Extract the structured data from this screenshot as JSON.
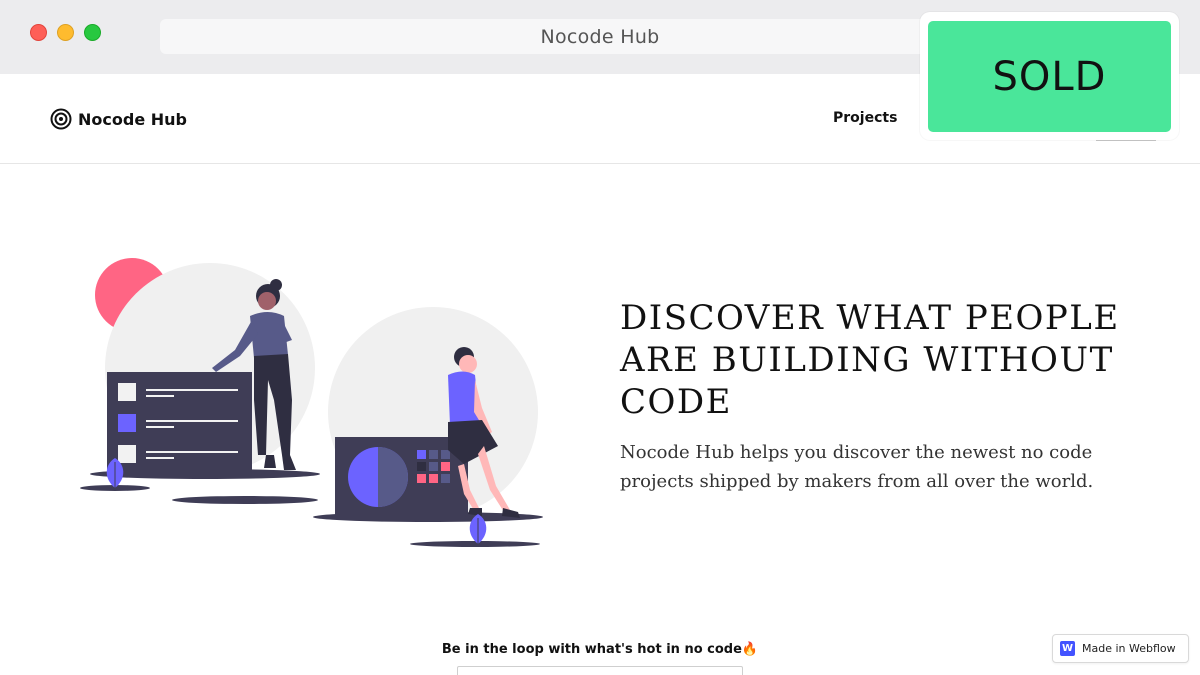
{
  "browser": {
    "address_text": "Nocode Hub"
  },
  "nav": {
    "brand": "Nocode Hub",
    "brand_icon": "target-icon",
    "links": [
      {
        "label": "Projects"
      }
    ]
  },
  "badge": {
    "label": "SOLD",
    "color": "#4ae69a"
  },
  "hero": {
    "title": "DISCOVER WHAT PEOPLE ARE BUILDING WITHOUT CODE",
    "description": "Nocode Hub helps you discover the newest no code projects shipped by makers from all over the world.",
    "illustration": "people-with-dashboard-illustration",
    "accent_color": "#6c63ff",
    "pink_color": "#ff6584"
  },
  "newsletter": {
    "title": "Be in the loop with what's hot in no code🔥"
  },
  "footer_badge": {
    "label": "Made in Webflow",
    "icon_letter": "W",
    "color": "#4353ff"
  }
}
